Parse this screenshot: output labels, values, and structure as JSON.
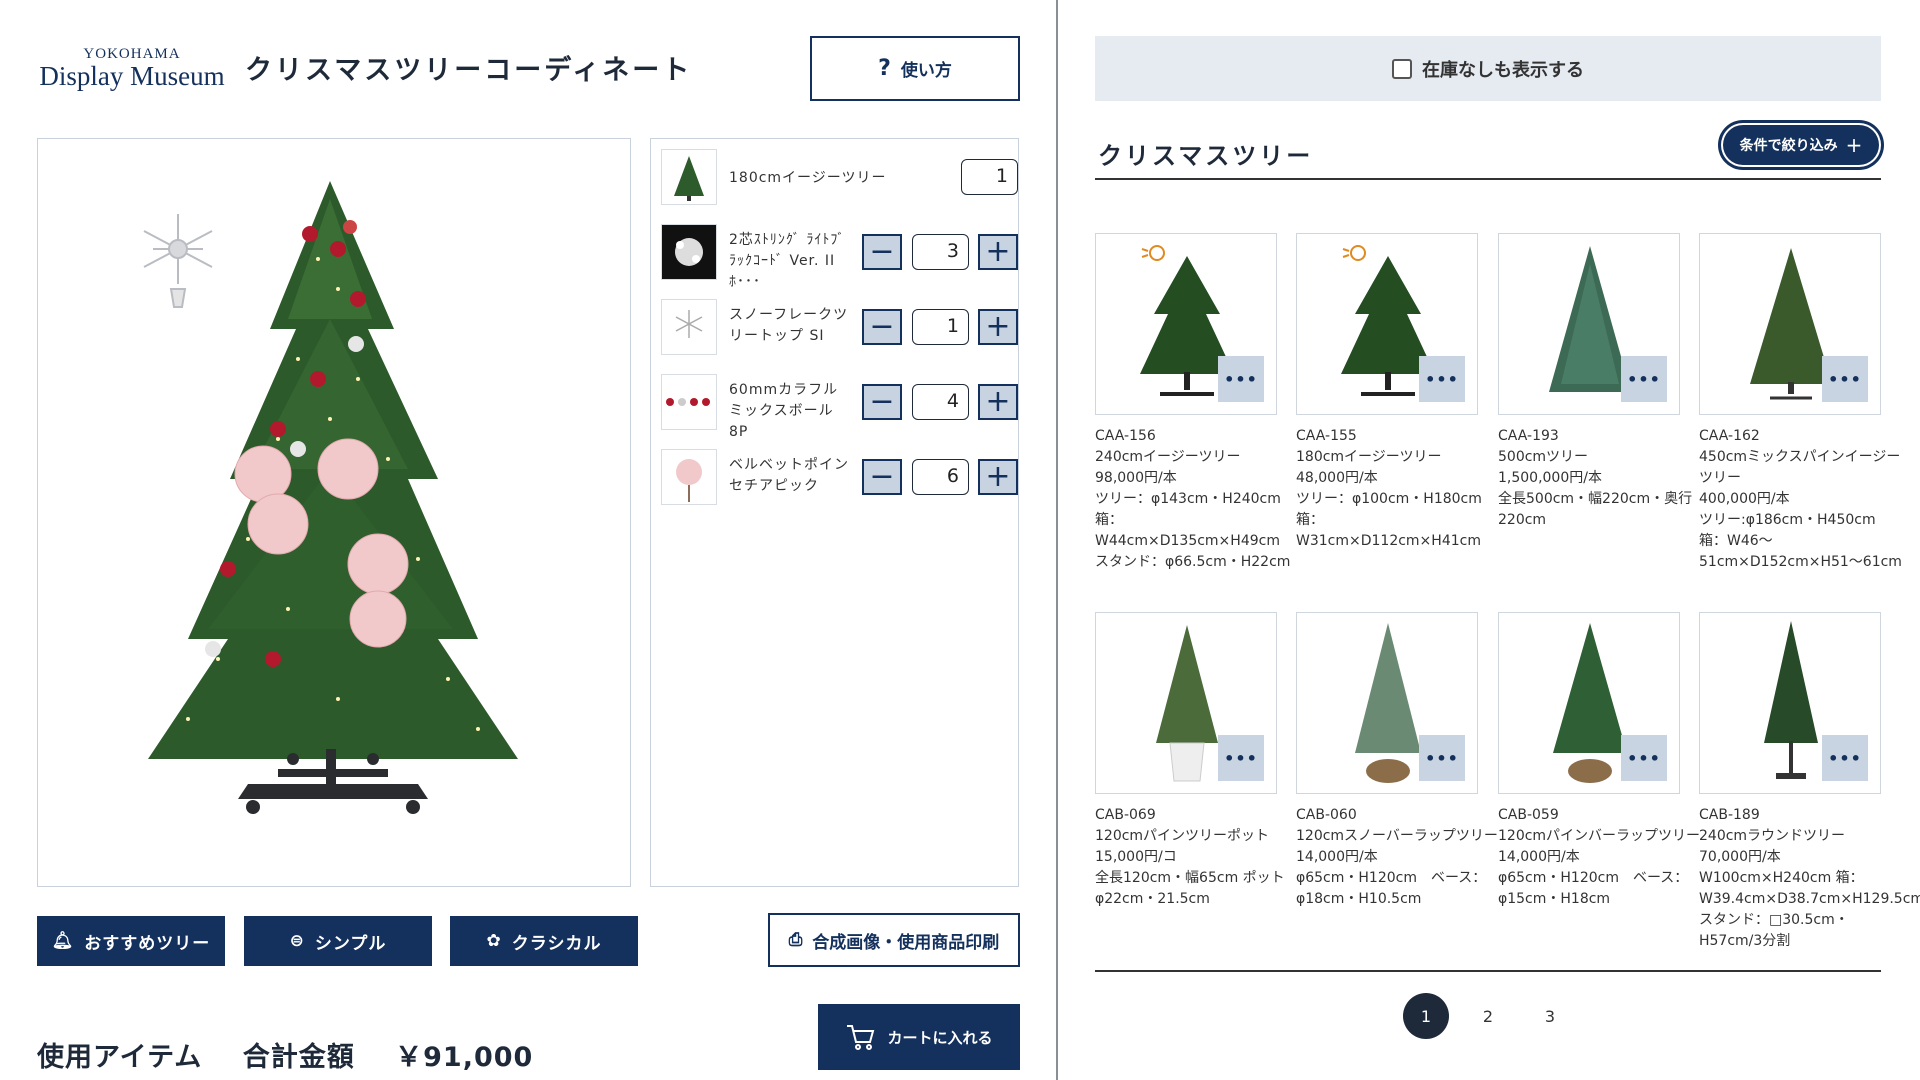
{
  "logo": {
    "small": "YOKOHAMA",
    "big": "Display Museum"
  },
  "app_title": "クリスマスツリーコーディネート",
  "help_label": "使い方",
  "items": [
    {
      "name": "180cmイージーツリー",
      "qty": "1",
      "thumb": "tree-icon"
    },
    {
      "name": "2芯ｽﾄﾘﾝｸﾞ ﾗｲﾄﾌﾞﾗｯｸｺｰﾄﾞ Ver. II ﾎ･･･",
      "qty": "3",
      "thumb": "light-string-icon"
    },
    {
      "name": "スノーフレークツリートップ SI",
      "qty": "1",
      "thumb": "snowflake-topper-icon"
    },
    {
      "name": "60mmカラフルミックスボール8P",
      "qty": "4",
      "thumb": "ornament-balls-icon"
    },
    {
      "name": "ベルベットポインセチアピック",
      "qty": "6",
      "thumb": "poinsettia-icon"
    }
  ],
  "style_buttons": [
    {
      "label": "おすすめツリー",
      "icon": "bell-icon"
    },
    {
      "label": "シンプル",
      "icon": "ornament-icon"
    },
    {
      "label": "クラシカル",
      "icon": "bow-icon"
    }
  ],
  "print_label": "合成画像・使用商品印刷",
  "total": {
    "label1": "使用アイテム",
    "label2": "合計金額",
    "amount": "￥91,000"
  },
  "cart_label": "カートに入れる",
  "stock_label": "在庫なしも表示する",
  "category_title": "クリスマスツリー",
  "filter_label": "条件で絞り込み",
  "products": [
    {
      "code": "CAA-156",
      "lines": [
        "240cmイージーツリー",
        "98,000円/本",
        "ツリー：φ143cm・H240cm　箱：W44cm×D135cm×H49cm",
        "スタンド：φ66.5cm・H22cm"
      ],
      "badge": true,
      "shape": "tree-a"
    },
    {
      "code": "CAA-155",
      "lines": [
        "180cmイージーツリー",
        "48,000円/本",
        "ツリー：φ100cm・H180cm 箱：W31cm×D112cm×H41cm"
      ],
      "badge": true,
      "shape": "tree-a"
    },
    {
      "code": "CAA-193",
      "lines": [
        "500cmツリー",
        "1,500,000円/本",
        "全長500cm・幅220cm・奥行220cm"
      ],
      "badge": false,
      "shape": "tree-b"
    },
    {
      "code": "CAA-162",
      "lines": [
        "450cmミックスパインイージーツリー",
        "400,000円/本",
        "ツリー:φ186cm・H450cm 箱：W46～51cm×D152cm×H51～61cm"
      ],
      "badge": false,
      "shape": "tree-c"
    },
    {
      "code": "CAB-069",
      "lines": [
        "120cmパインツリーポット",
        "15,000円/コ",
        "全長120cm・幅65cm ポット φ22cm・21.5cm"
      ],
      "badge": false,
      "shape": "tree-pot-white"
    },
    {
      "code": "CAB-060",
      "lines": [
        "120cmスノーバーラップツリー",
        "14,000円/本",
        "φ65cm・H120cm　ベース：φ18cm・H10.5cm"
      ],
      "badge": false,
      "shape": "tree-burlap-snow"
    },
    {
      "code": "CAB-059",
      "lines": [
        "120cmパインバーラップツリー",
        "14,000円/本",
        "φ65cm・H120cm　ベース：φ15cm・H18cm"
      ],
      "badge": false,
      "shape": "tree-burlap"
    },
    {
      "code": "CAB-189",
      "lines": [
        "240cmラウンドツリー",
        "70,000円/本",
        "W100cm×H240cm 箱：W39.4cm×D38.7cm×H129.5cm",
        "スタンド：□30.5cm・H57cm/3分割"
      ],
      "badge": false,
      "shape": "tree-stand"
    }
  ],
  "pages": [
    "1",
    "2",
    "3"
  ],
  "colors": {
    "navy": "#14305c",
    "light_blue": "#c8d4e1",
    "bar_bg": "#e6eaf1"
  }
}
